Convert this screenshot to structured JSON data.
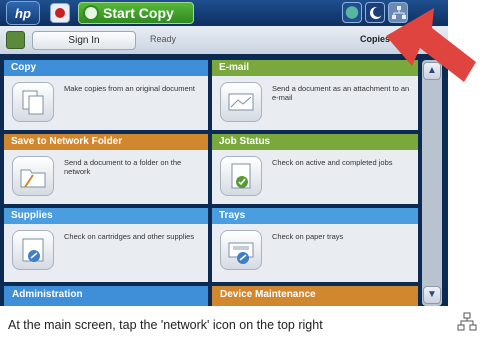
{
  "topbar": {
    "logo": "hp",
    "start_copy": "Start Copy"
  },
  "status": {
    "sign_in": "Sign In",
    "state": "Ready",
    "mode": "Copies"
  },
  "tiles": {
    "copy": {
      "title": "Copy",
      "desc": "Make copies from an original document"
    },
    "email": {
      "title": "E-mail",
      "desc": "Send a document as an attachment to an e-mail"
    },
    "save_network": {
      "title": "Save to Network Folder",
      "desc": "Send a document to a folder on the network"
    },
    "job_status": {
      "title": "Job Status",
      "desc": "Check on active and completed jobs"
    },
    "supplies": {
      "title": "Supplies",
      "desc": "Check on cartridges and other supplies"
    },
    "trays": {
      "title": "Trays",
      "desc": "Check on paper trays"
    },
    "administration": {
      "title": "Administration"
    },
    "device_maintenance": {
      "title": "Device Maintenance"
    }
  },
  "caption": "At the main screen, tap the 'network' icon on the top right",
  "colors": {
    "arrow": "#e0443f",
    "accent_green": "#7aa83c",
    "accent_blue": "#3f8fd8"
  }
}
